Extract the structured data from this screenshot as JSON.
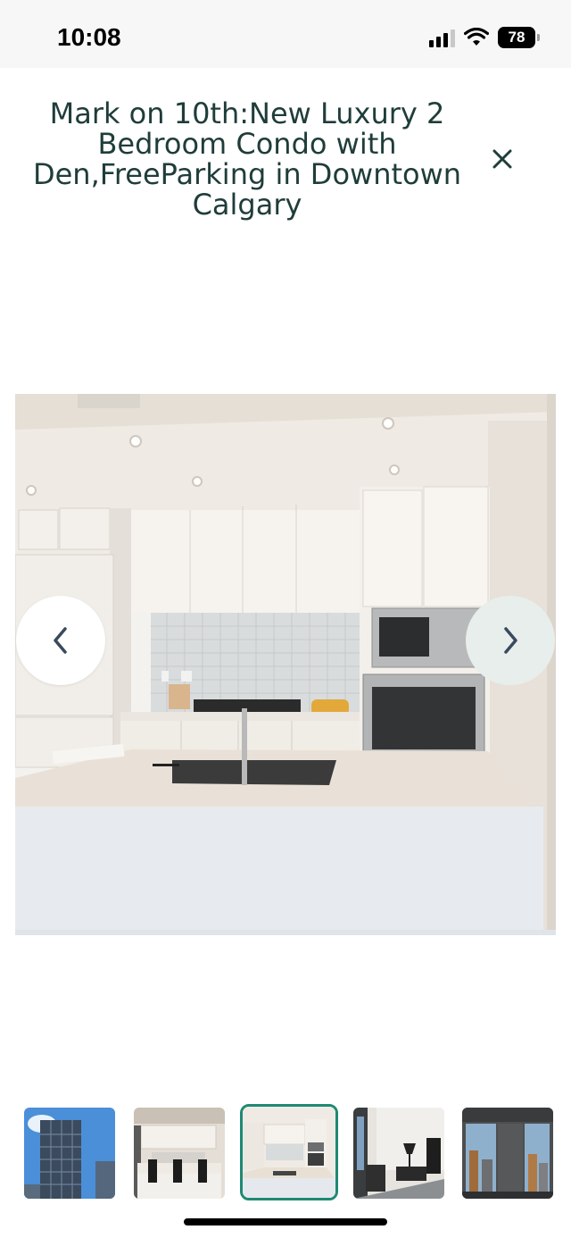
{
  "status_bar": {
    "time": "10:08",
    "battery": "78",
    "icons": [
      "signal-icon",
      "wifi-icon",
      "battery-icon"
    ]
  },
  "header": {
    "title": "Mark on 10th:New Luxury 2 Bedroom Condo with Den,FreeParking in Downtown Calgary",
    "close_icon": "close-icon"
  },
  "gallery": {
    "current_photo": "kitchen-photo",
    "prev_icon": "chevron-left-icon",
    "next_icon": "chevron-right-icon",
    "thumbnails": [
      {
        "name": "thumbnail-building-exterior",
        "active": false
      },
      {
        "name": "thumbnail-kitchen-island",
        "active": false
      },
      {
        "name": "thumbnail-kitchen",
        "active": true
      },
      {
        "name": "thumbnail-bedroom",
        "active": false
      },
      {
        "name": "thumbnail-window-view",
        "active": false
      }
    ]
  },
  "colors": {
    "title": "#1f3d3a",
    "accent": "#1e8a73",
    "next_button_bg": "#e8eeeb"
  }
}
